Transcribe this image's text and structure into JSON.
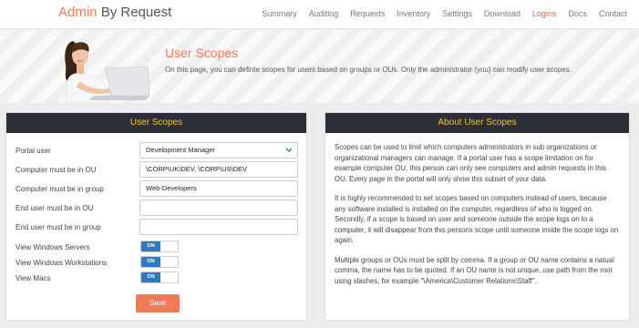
{
  "brand": {
    "part1": "Admin",
    "part2": " By Request"
  },
  "nav": {
    "summary": "Summary",
    "auditlog": "Auditlog",
    "requests": "Requests",
    "inventory": "Inventory",
    "settings": "Settings",
    "download": "Download",
    "logins": "Logins",
    "docs": "Docs",
    "contact": "Contact"
  },
  "hero": {
    "title": "User Scopes",
    "description": "On this page, you can definte scopes for users based on groups or OUs. Only the administrator (you) can modify user scopes."
  },
  "form": {
    "heading": "User Scopes",
    "portal_user_label": "Portal user",
    "portal_user_value": "Development Manager",
    "computer_ou_label": "Computer must be in OU",
    "computer_ou_value": "\\CORP\\UK\\DEV, \\CORP\\US\\DEV",
    "computer_group_label": "Computer must be in group",
    "computer_group_value": "Web-Developers",
    "enduser_ou_label": "End user must be in OU",
    "enduser_ou_value": "",
    "enduser_group_label": "End user must be in group",
    "enduser_group_value": "",
    "servers_label": "View Windows Servers",
    "workstations_label": "View Windows Workstations",
    "macs_label": "View Macs",
    "toggle_on": "ON",
    "servers_on": true,
    "workstations_on": true,
    "macs_on": true,
    "save_label": "Save"
  },
  "about": {
    "heading": "About User Scopes",
    "p1": "Scopes can be used to limit which computers administrators in sub organizations or organizational managers can manage. If a portal user has a scope limitation on for example computer OU, this person can only see computers and admin requests in this OU. Every page in the portal will only show this subset of your data.",
    "p2": "It is highly recommended to set scopes based on computers instead of users, because any software installed is installed on the computer, regardless of who is logged on. Secondly, if a scope is based on user and someone outside the scope logs on to a computer, it will disappear from this persons scope until someone inside the scope logs on again.",
    "p3": "Multiple groups or OUs must be split by comma. If a group or OU name contains a natual comma, the name has to be quoted. If an OU name is not unique, use path from the root using slashes, for example \"\\America\\Customer Relations\\Staff\"."
  },
  "colors": {
    "accent": "#f07a57",
    "active_nav": "#e8594a",
    "panel_header_bg": "#2b2f3a",
    "panel_header_text": "#f5c430",
    "toggle_on": "#2e7bc4"
  }
}
